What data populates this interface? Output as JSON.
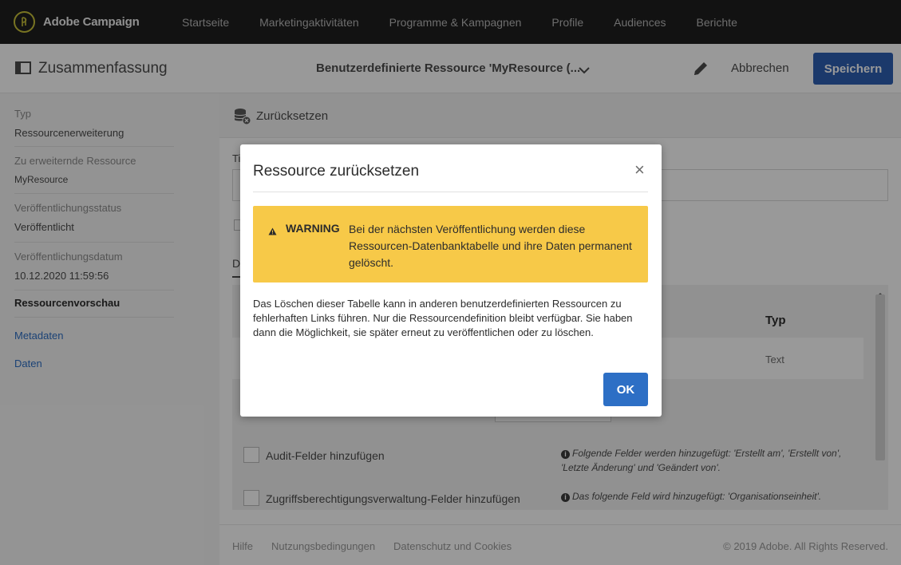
{
  "app": {
    "title": "Adobe Campaign",
    "nav": [
      "Startseite",
      "Marketingaktivitäten",
      "Programme & Kampagnen",
      "Profile",
      "Audiences",
      "Berichte"
    ]
  },
  "actionbar": {
    "summary_title": "Zusammenfassung",
    "resource_title": "Benutzerdefinierte Ressource 'MyResource (...",
    "cancel_label": "Abbrechen",
    "save_label": "Speichern"
  },
  "sidebar": {
    "fields": [
      {
        "label": "Typ",
        "value": "Ressourcenerweiterung"
      },
      {
        "label": "Zu erweiternde Ressource",
        "value": "MyResource"
      },
      {
        "label": "Veröffentlichungsstatus",
        "value": "Veröffentlicht"
      },
      {
        "label": "Veröffentlichungsdatum",
        "value": "10.12.2020 11:59:56"
      }
    ],
    "section_title": "Ressourcenvorschau",
    "links": [
      "Metadaten",
      "Daten"
    ]
  },
  "main": {
    "header_label": "Zurücksetzen",
    "label_partial": "Ti",
    "tab_partial": "D",
    "table": {
      "col_typ": "Typ",
      "cell_typ": "Text"
    },
    "options": [
      {
        "label": "Audit-Felder hinzufügen",
        "info": "Folgende Felder werden hinzugefügt: 'Erstellt am', 'Erstellt von', 'Letzte Änderung' und 'Geändert von'."
      },
      {
        "label": "Zugriffsberechtigungsverwaltung-Felder hinzufügen",
        "info": "Das folgende Feld wird hinzugefügt: 'Organisationseinheit'."
      }
    ]
  },
  "footer": {
    "links": [
      "Hilfe",
      "Nutzungsbedingungen",
      "Datenschutz und Cookies"
    ],
    "copyright": "© 2019 Adobe. All Rights Reserved."
  },
  "dialog": {
    "title": "Ressource zurücksetzen",
    "warning_label": "WARNING",
    "warning_text": "Bei der nächsten Veröffentlichung werden diese Ressourcen-Datenbanktabelle und ihre Daten permanent gelöscht.",
    "body": "Das Löschen dieser Tabelle kann in anderen benutzerdefinierten Ressourcen zu fehlerhaften Links führen. Nur die Ressourcendefinition bleibt verfügbar. Sie haben dann die Möglichkeit, sie später erneut zu veröffentlichen oder zu löschen.",
    "ok_label": "OK"
  },
  "colors": {
    "topbar": "#1e1e1e",
    "primary_button": "#2d5fb2",
    "ok_button": "#2d6fc5",
    "warning": "#f7c948",
    "link": "#2d6fc5"
  }
}
